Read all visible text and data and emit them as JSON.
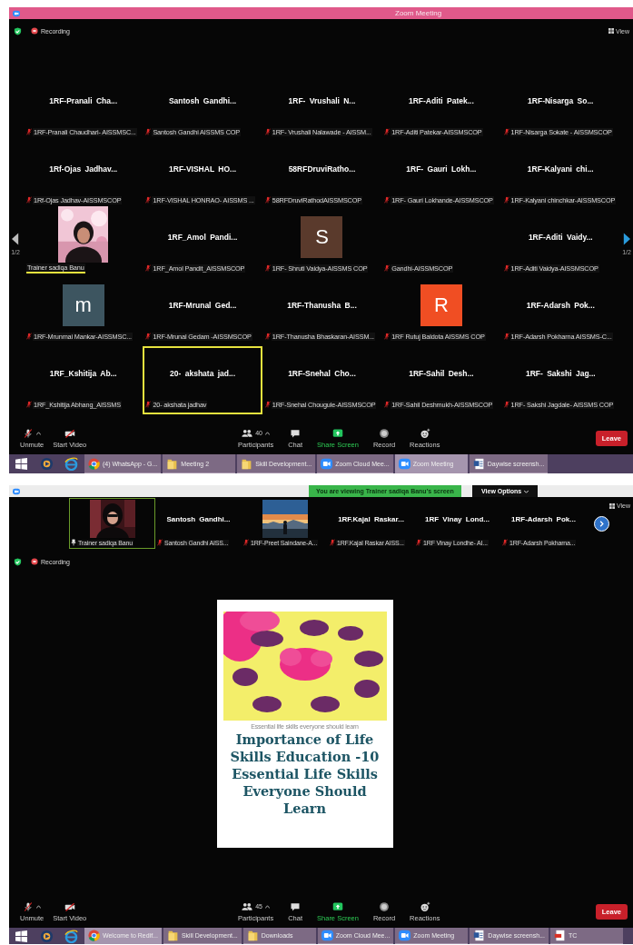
{
  "gallery": {
    "window": {
      "title": "Zoom Meeting"
    },
    "recording": "Recording",
    "view": "View",
    "pager": {
      "left": "1/2",
      "right": "1/2"
    },
    "tiles": [
      {
        "kind": "name",
        "display": "1RF-Pranali Cha...",
        "name": "1RF-Pranali Chaudhari- AISSMSC...",
        "muted": true,
        "selected": false,
        "speaking": false
      },
      {
        "kind": "name",
        "display": "Santosh Gandhi...",
        "name": "Santosh Gandhi AISSMS COP",
        "muted": true,
        "selected": false,
        "speaking": false
      },
      {
        "kind": "name",
        "display": "1RF- Vrushali N...",
        "name": "1RF- Vrushali Nalawade - AISSM...",
        "muted": true,
        "selected": false,
        "speaking": false
      },
      {
        "kind": "name",
        "display": "1RF-Aditi Patek...",
        "name": "1RF-Aditi Patekar-AISSMSCOP",
        "muted": true,
        "selected": false,
        "speaking": false
      },
      {
        "kind": "name",
        "display": "1RF-Nisarga So...",
        "name": "1RF-Nisarga Sokate - AISSMSCOP",
        "muted": true,
        "selected": false,
        "speaking": false
      },
      {
        "kind": "name",
        "display": "1Rf-Ojas Jadhav...",
        "name": "1Rf-Ojas Jadhav-AISSMSCOP",
        "muted": true,
        "selected": false,
        "speaking": false
      },
      {
        "kind": "name",
        "display": "1RF-VISHAL HO...",
        "name": "1RF-VISHAL HONRAO- AISSMS ...",
        "muted": true,
        "selected": false,
        "speaking": false
      },
      {
        "kind": "name",
        "display": "58RFDruviRatho...",
        "name": "58RFDruviRathodAISSMSCOP",
        "muted": true,
        "selected": false,
        "speaking": false
      },
      {
        "kind": "name",
        "display": "1RF- Gauri Lokh...",
        "name": "1RF- Gauri Lokhande-AISSMSCOP",
        "muted": true,
        "selected": false,
        "speaking": false
      },
      {
        "kind": "name",
        "display": "1RF-Kalyani chi...",
        "name": "1RF-Kalyani chinchkar-AISSMSCOP",
        "muted": true,
        "selected": false,
        "speaking": false
      },
      {
        "kind": "video",
        "name": "Trainer sadiqa Banu",
        "muted": false,
        "selected": false,
        "speaking": true
      },
      {
        "kind": "name",
        "display": "1RF_Amol Pandi...",
        "name": "1RF_Amol Pandit_AISSMSCOP",
        "muted": true,
        "selected": false,
        "speaking": false
      },
      {
        "kind": "letter",
        "letter": "S",
        "color": "#5a3a2c",
        "name": "1RF- Shruti Vaidya-AISSMS COP",
        "muted": true,
        "selected": false,
        "speaking": false
      },
      {
        "kind": "blank",
        "name": "Gandhi-AISSMSCOP",
        "muted": true,
        "selected": false,
        "speaking": false
      },
      {
        "kind": "name",
        "display": "1RF-Aditi Vaidy...",
        "name": "1RF-Aditi Vaidya-AISSMSCOP",
        "muted": true,
        "selected": false,
        "speaking": false
      },
      {
        "kind": "letter",
        "letter": "m",
        "color": "#3d5560",
        "name": "1RF-Mrunmai Mankar-AISSMSC...",
        "muted": true,
        "selected": false,
        "speaking": false
      },
      {
        "kind": "name",
        "display": "1RF-Mrunal Ged...",
        "name": "1RF-Mrunal Gedam -AISSMSCOP",
        "muted": true,
        "selected": false,
        "speaking": false
      },
      {
        "kind": "name",
        "display": "1RF-Thanusha B...",
        "name": "1RF-Thanusha Bhaskaran-AISSM...",
        "muted": true,
        "selected": false,
        "speaking": false
      },
      {
        "kind": "letter",
        "letter": "R",
        "color": "#f04e23",
        "name": "1RF Rutuj Baldota AISSMS COP",
        "muted": true,
        "selected": false,
        "speaking": false
      },
      {
        "kind": "name",
        "display": "1RF-Adarsh Pok...",
        "name": "1RF-Adarsh Pokharna AISSMS-C...",
        "muted": true,
        "selected": false,
        "speaking": false
      },
      {
        "kind": "name",
        "display": "1RF_Kshitija Ab...",
        "name": "1RF_Kshitija Abhang_AISSMS",
        "muted": true,
        "selected": false,
        "speaking": false
      },
      {
        "kind": "name",
        "display": "20- akshata jad...",
        "name": "20- akshata jadhav",
        "muted": true,
        "selected": true,
        "speaking": false
      },
      {
        "kind": "name",
        "display": "1RF-Snehal Cho...",
        "name": "1RF-Snehal Chougule-AISSMSCOP",
        "muted": true,
        "selected": false,
        "speaking": false
      },
      {
        "kind": "name",
        "display": "1RF-Sahil Desh...",
        "name": "1RF-Sahil Deshmukh-AISSMSCOP",
        "muted": true,
        "selected": false,
        "speaking": false
      },
      {
        "kind": "name",
        "display": "1RF- Sakshi Jag...",
        "name": "1RF- Sakshi Jagdale- AISSMS COP",
        "muted": true,
        "selected": false,
        "speaking": false
      }
    ],
    "toolbar": {
      "left": [
        {
          "kind": "mic",
          "label": "Unmute",
          "caret": true
        },
        {
          "kind": "camera",
          "label": "Start Video",
          "caret": false
        }
      ],
      "center": [
        {
          "kind": "participants",
          "label": "Participants",
          "count": "40",
          "caret": true
        },
        {
          "kind": "chat",
          "label": "Chat",
          "caret": false
        },
        {
          "kind": "share",
          "label": "Share Screen",
          "caret": false
        },
        {
          "kind": "record",
          "label": "Record",
          "caret": false
        },
        {
          "kind": "reactions",
          "label": "Reactions",
          "caret": false
        }
      ],
      "leave": "Leave"
    },
    "taskbar": [
      {
        "kind": "chrome",
        "label": "(4) WhatsApp - G...",
        "selected": false
      },
      {
        "kind": "folder",
        "label": "Meeting 2",
        "selected": false
      },
      {
        "kind": "folder",
        "label": "Skill Development...",
        "selected": false
      },
      {
        "kind": "zoom",
        "label": "Zoom Cloud Mee...",
        "selected": false
      },
      {
        "kind": "zoom",
        "label": "Zoom Meeting",
        "selected": true
      },
      {
        "kind": "doc",
        "label": "Daywise screensh...",
        "selected": false
      }
    ]
  },
  "share": {
    "banner": "You are viewing Trainer sadiqa Banu's screen",
    "view_options": "View Options",
    "view": "View",
    "recording": "Recording",
    "filmstrip": [
      {
        "kind": "video",
        "name": "Trainer sadiqa Banu",
        "pinned": true,
        "muted": false,
        "selected": true
      },
      {
        "kind": "name",
        "display": "Santosh Gandhi...",
        "name": "Santosh Gandhi AISS...",
        "pinned": false,
        "muted": true,
        "selected": false
      },
      {
        "kind": "picture",
        "name": "1RF-Preet Saindane-A...",
        "pinned": false,
        "muted": true,
        "selected": false
      },
      {
        "kind": "name",
        "display": "1RF.Kajal Raskar...",
        "name": "1RF.Kajal Raskar AISS...",
        "pinned": false,
        "muted": true,
        "selected": false
      },
      {
        "kind": "name",
        "display": "1RF Vinay Lond...",
        "name": "1RF Vinay Londhe- AI...",
        "pinned": false,
        "muted": true,
        "selected": false
      },
      {
        "kind": "name",
        "display": "1RF-Adarsh Pok...",
        "name": "1RF-Adarsh Pokharna...",
        "pinned": false,
        "muted": true,
        "selected": false
      }
    ],
    "slide": {
      "caption": "Essential life skills everyone should learn",
      "title": "Importance of Life Skills Education -10 Essential Life Skills Everyone Should Learn"
    },
    "toolbar": {
      "left": [
        {
          "kind": "mic",
          "label": "Unmute",
          "caret": true
        },
        {
          "kind": "camera",
          "label": "Start Video",
          "caret": false
        }
      ],
      "center": [
        {
          "kind": "participants",
          "label": "Participants",
          "count": "45",
          "caret": true
        },
        {
          "kind": "chat",
          "label": "Chat",
          "caret": false
        },
        {
          "kind": "share",
          "label": "Share Screen",
          "caret": false
        },
        {
          "kind": "record",
          "label": "Record",
          "caret": false
        },
        {
          "kind": "reactions",
          "label": "Reactions",
          "caret": false
        }
      ],
      "leave": "Leave"
    },
    "taskbar": [
      {
        "kind": "chrome",
        "label": "Welcome to Redif...",
        "selected": true
      },
      {
        "kind": "folder",
        "label": "Skill Development...",
        "selected": false
      },
      {
        "kind": "folder",
        "label": "Downloads",
        "selected": false
      },
      {
        "kind": "zoom",
        "label": "Zoom Cloud Mee...",
        "selected": false
      },
      {
        "kind": "zoom",
        "label": "Zoom Meeting",
        "selected": false
      },
      {
        "kind": "doc",
        "label": "Daywise screensh...",
        "selected": false
      },
      {
        "kind": "pdf",
        "label": "TC",
        "selected": false
      }
    ]
  }
}
